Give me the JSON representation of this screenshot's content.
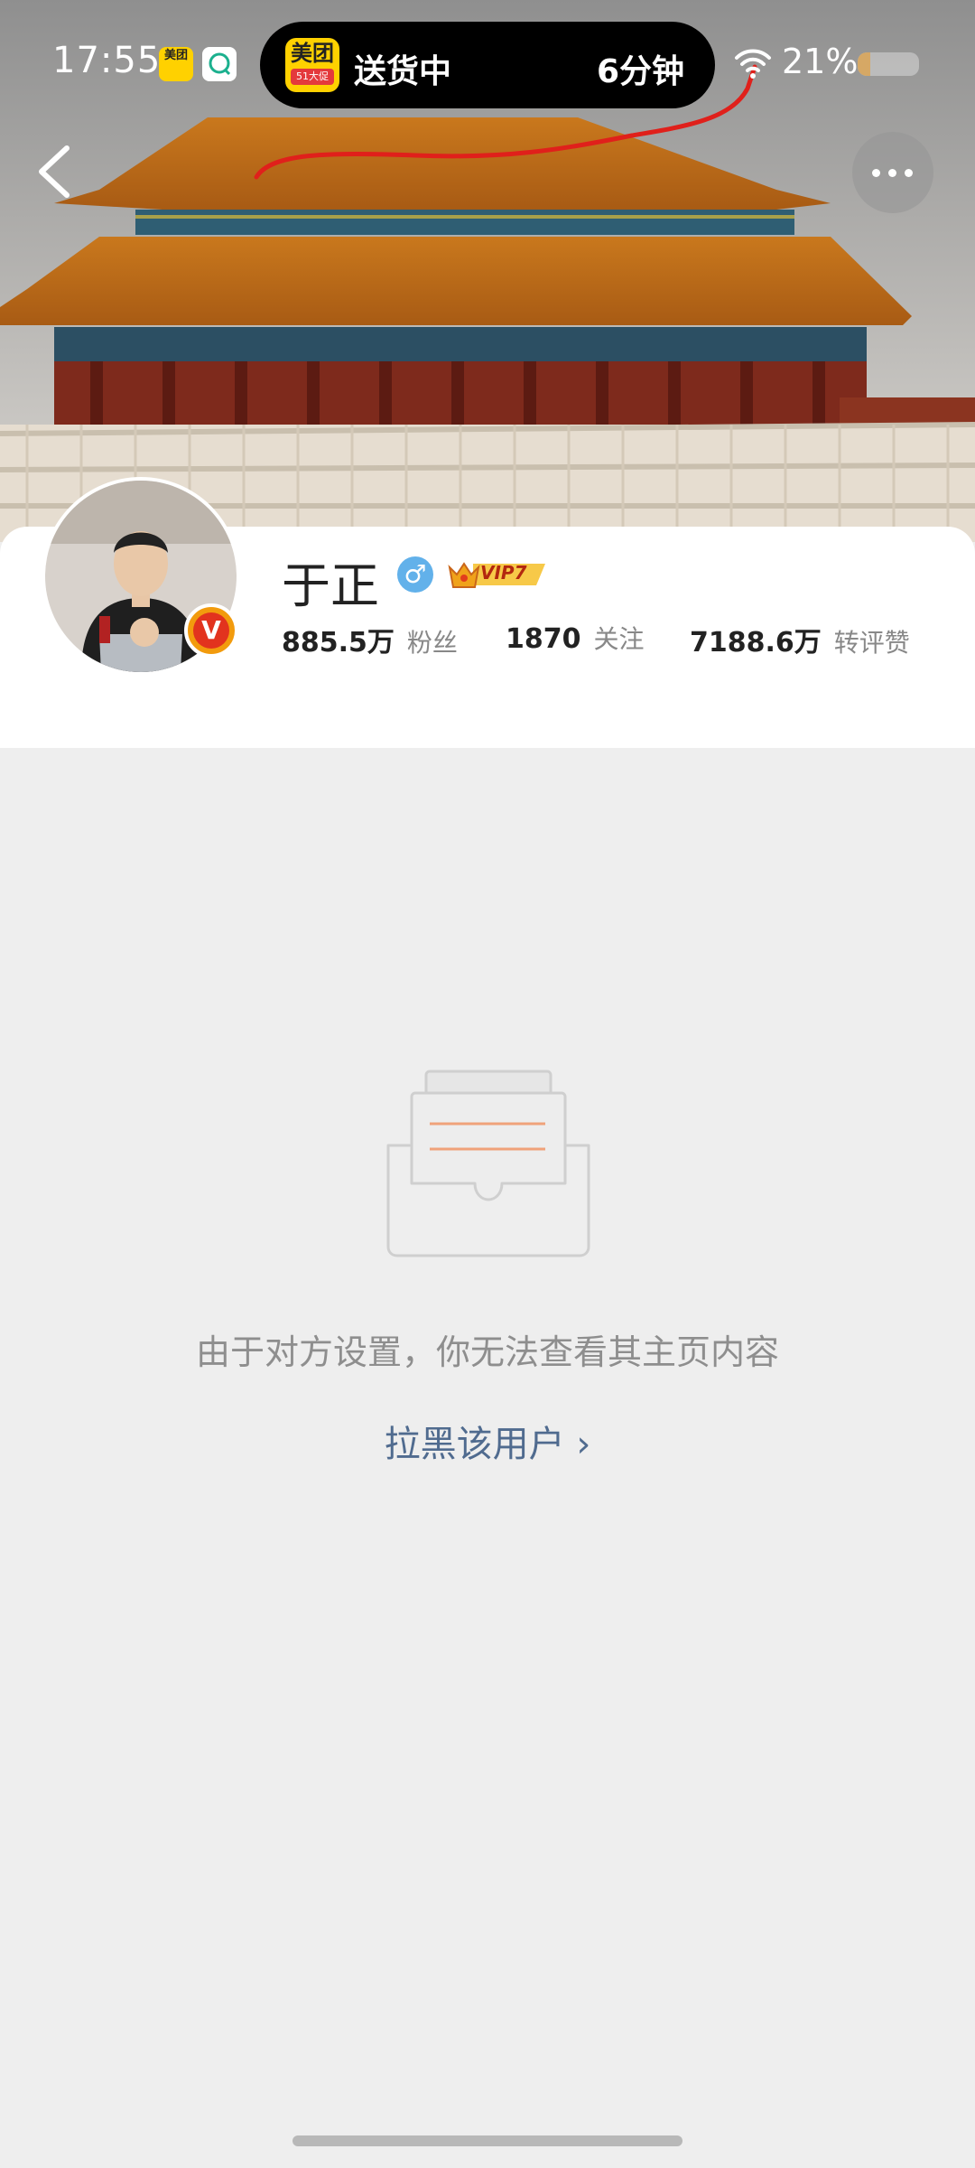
{
  "status_bar": {
    "time": "17:55",
    "meituan_mini": "美团",
    "island": {
      "logo_top": "美团",
      "logo_bottom": "51大促",
      "status": "送货中",
      "eta": "6分钟"
    },
    "battery_percent": "21%",
    "battery_level": 0.21
  },
  "profile": {
    "name": "于正",
    "gender": "♂",
    "vip": "VIP7",
    "verified_badge": "V",
    "stats": [
      {
        "value": "885.5万",
        "label": "粉丝"
      },
      {
        "value": "1870",
        "label": "关注"
      },
      {
        "value": "7188.6万",
        "label": "转评赞"
      }
    ]
  },
  "empty_state": {
    "message": "由于对方设置，你无法查看其主页内容",
    "block_link": "拉黑该用户 ›"
  },
  "colors": {
    "link": "#506b8f",
    "verify_badge": "#e2331e",
    "gender_badge": "#62b1ea",
    "annotation": "#e0201b"
  }
}
